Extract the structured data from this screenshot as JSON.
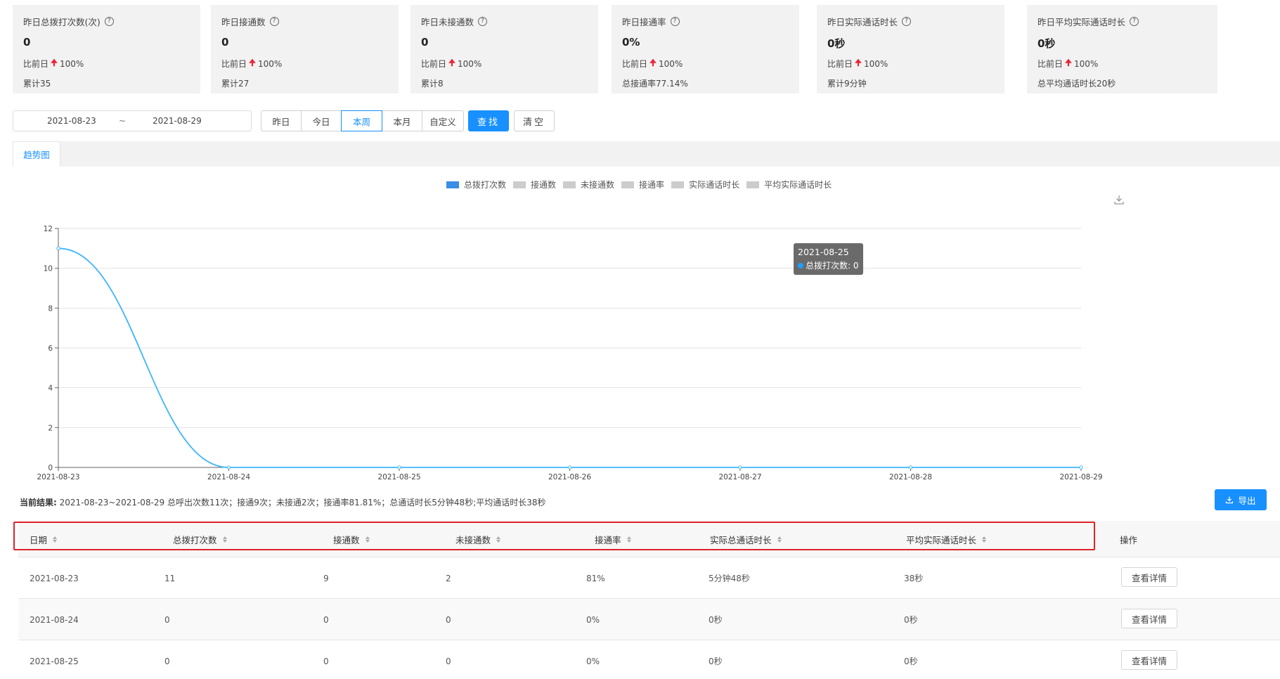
{
  "stats": [
    {
      "title": "昨日总拨打次数(次)",
      "value": "0",
      "compare_label": "比前日",
      "compare_value": "100%",
      "total": "累计35"
    },
    {
      "title": "昨日接通数",
      "value": "0",
      "compare_label": "比前日",
      "compare_value": "100%",
      "total": "累计27"
    },
    {
      "title": "昨日未接通数",
      "value": "0",
      "compare_label": "比前日",
      "compare_value": "100%",
      "total": "累计8"
    },
    {
      "title": "昨日接通率",
      "value": "0%",
      "compare_label": "比前日",
      "compare_value": "100%",
      "total": "总接通率77.14%"
    },
    {
      "title": "昨日实际通话时长",
      "value": "0秒",
      "compare_label": "比前日",
      "compare_value": "100%",
      "total": "累计9分钟"
    },
    {
      "title": "昨日平均实际通话时长",
      "value": "0秒",
      "compare_label": "比前日",
      "compare_value": "100%",
      "total": "总平均通话时长20秒"
    }
  ],
  "filter": {
    "start_date": "2021-08-23",
    "separator": "~",
    "end_date": "2021-08-29",
    "periods": [
      "昨日",
      "今日",
      "本周",
      "本月",
      "自定义"
    ],
    "active_period": "本周",
    "search_label": "查找",
    "clear_label": "清空"
  },
  "tabs": {
    "trend": "趋势图"
  },
  "legend": [
    {
      "label": "总拨打次数",
      "color": "#3a8ee6"
    },
    {
      "label": "接通数",
      "color": "#cccccc"
    },
    {
      "label": "未接通数",
      "color": "#cccccc"
    },
    {
      "label": "接通率",
      "color": "#cccccc"
    },
    {
      "label": "实际通话时长",
      "color": "#cccccc"
    },
    {
      "label": "平均实际通话时长",
      "color": "#cccccc"
    }
  ],
  "chart_data": {
    "type": "line",
    "x": [
      "2021-08-23",
      "2021-08-24",
      "2021-08-25",
      "2021-08-26",
      "2021-08-27",
      "2021-08-28",
      "2021-08-29"
    ],
    "series": [
      {
        "name": "总拨打次数",
        "values": [
          11,
          0,
          0,
          0,
          0,
          0,
          0
        ],
        "color": "#3fb5ff"
      }
    ],
    "ylim": [
      0,
      12
    ],
    "yticks": [
      0,
      2,
      4,
      6,
      8,
      10,
      12
    ],
    "grid": true
  },
  "tooltip": {
    "date": "2021-08-25",
    "text": "总拨打次数: 0"
  },
  "summary": {
    "label": "当前结果:",
    "text": "2021-08-23~2021-08-29 总呼出次数11次；接通9次；未接通2次；接通率81.81%；总通话时长5分钟48秒;平均通话时长38秒"
  },
  "export_label": "导出",
  "table": {
    "headers": [
      "日期",
      "总拨打次数",
      "接通数",
      "未接通数",
      "接通率",
      "实际总通话时长",
      "平均实际通话时长",
      "操作"
    ],
    "rows": [
      [
        "2021-08-23",
        "11",
        "9",
        "2",
        "81%",
        "5分钟48秒",
        "38秒"
      ],
      [
        "2021-08-24",
        "0",
        "0",
        "0",
        "0%",
        "0秒",
        "0秒"
      ],
      [
        "2021-08-25",
        "0",
        "0",
        "0",
        "0%",
        "0秒",
        "0秒"
      ]
    ],
    "action_label": "查看详情"
  }
}
